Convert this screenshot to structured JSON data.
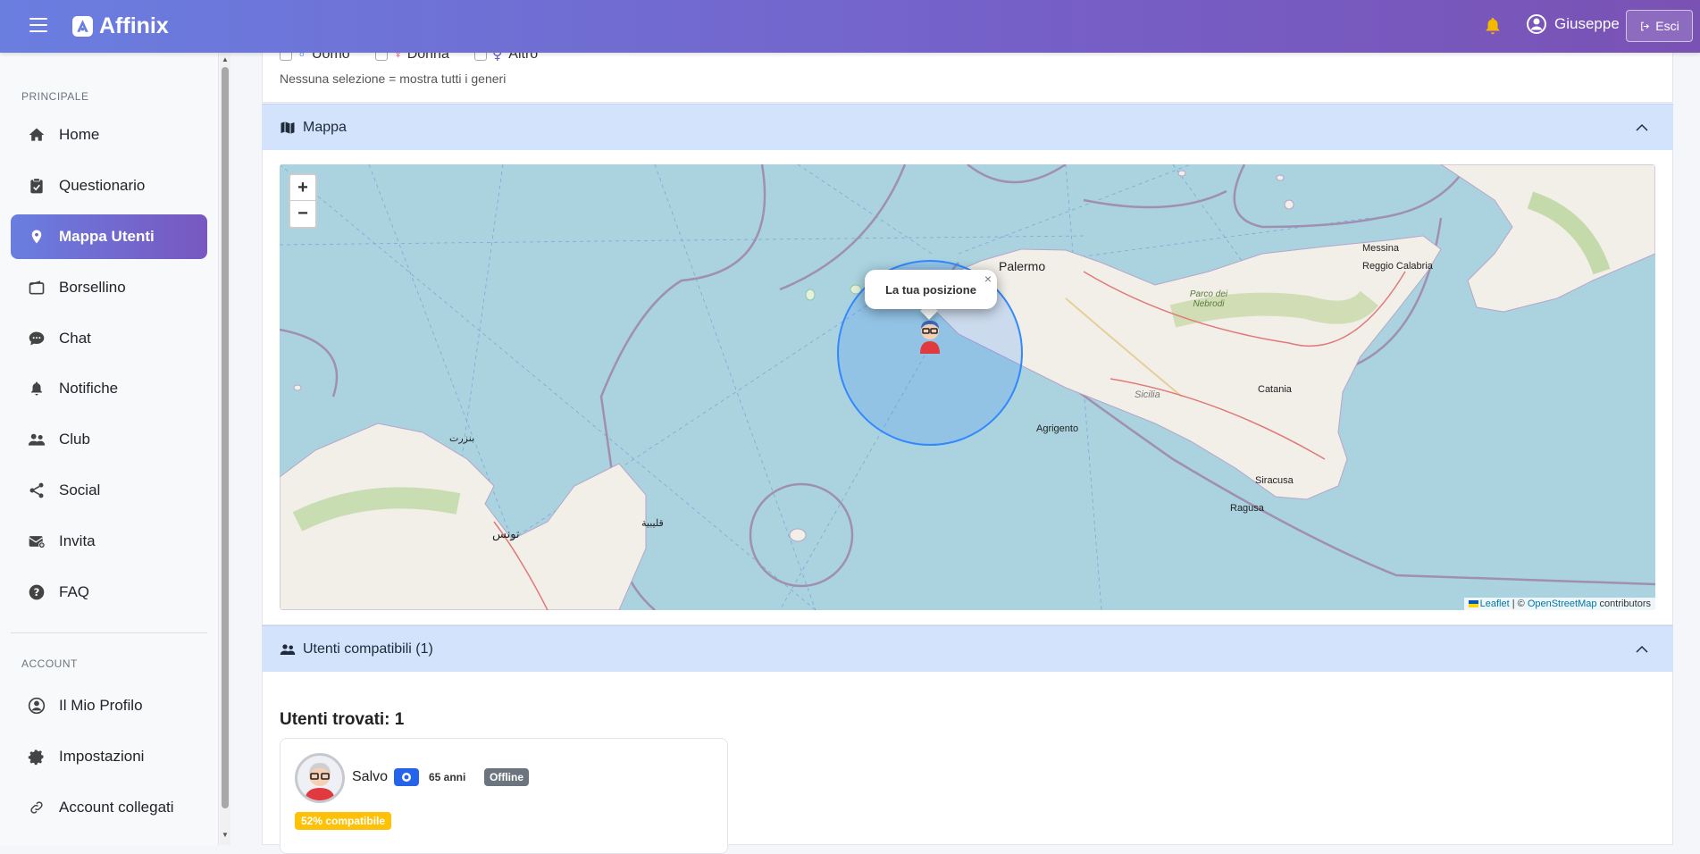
{
  "app": {
    "brand": "Affinix"
  },
  "header": {
    "user_name": "Giuseppe",
    "logout_label": "Esci"
  },
  "sidebar": {
    "section_main": "PRINCIPALE",
    "section_account": "ACCOUNT",
    "items": [
      {
        "label": "Home",
        "icon": "home-icon"
      },
      {
        "label": "Questionario",
        "icon": "clipboard-icon"
      },
      {
        "label": "Mappa Utenti",
        "icon": "map-marker-icon",
        "active": true
      },
      {
        "label": "Borsellino",
        "icon": "wallet-icon"
      },
      {
        "label": "Chat",
        "icon": "chat-icon"
      },
      {
        "label": "Notifiche",
        "icon": "bell-icon"
      },
      {
        "label": "Club",
        "icon": "users-icon"
      },
      {
        "label": "Social",
        "icon": "share-icon"
      },
      {
        "label": "Invita",
        "icon": "envelope-icon"
      },
      {
        "label": "FAQ",
        "icon": "question-icon"
      }
    ],
    "account_items": [
      {
        "label": "Il Mio Profilo",
        "icon": "user-circle-icon"
      },
      {
        "label": "Impostazioni",
        "icon": "gear-icon"
      },
      {
        "label": "Account collegati",
        "icon": "link-icon"
      }
    ]
  },
  "filters": {
    "genders": [
      "Uomo",
      "Donna",
      "Altro"
    ],
    "hint": "Nessuna selezione = mostra tutti i generi"
  },
  "map_section": {
    "title": "Mappa",
    "zoom_in": "+",
    "zoom_out": "−",
    "popup_text": "La tua posizione",
    "popup_close": "×",
    "attribution_leaflet": "Leaflet",
    "attribution_sep": " | © ",
    "attribution_osm": "OpenStreetMap",
    "attribution_tail": " contributors",
    "labels": {
      "palermo": "Palermo",
      "messina": "Messina",
      "reggio": "Reggio Calabria",
      "catania": "Catania",
      "agrigento": "Agrigento",
      "siracusa": "Siracusa",
      "ragusa": "Ragusa",
      "sicilia": "Sicilia",
      "nebrodi": "Parco dei Nebrodi",
      "tunis": "تونس",
      "bizerte": "بنزرت",
      "kelibia": "قليبية"
    }
  },
  "users_section": {
    "title": "Utenti compatibili (1)",
    "found": "Utenti trovati: 1",
    "users": [
      {
        "name": "Salvo",
        "age": "65 anni",
        "status": "Offline",
        "compat": "52% compatibile"
      }
    ]
  },
  "colors": {
    "accent": "#7560c8",
    "accordion": "#d3e3fc",
    "compat": "#ffc107",
    "verified": "#2563eb"
  }
}
